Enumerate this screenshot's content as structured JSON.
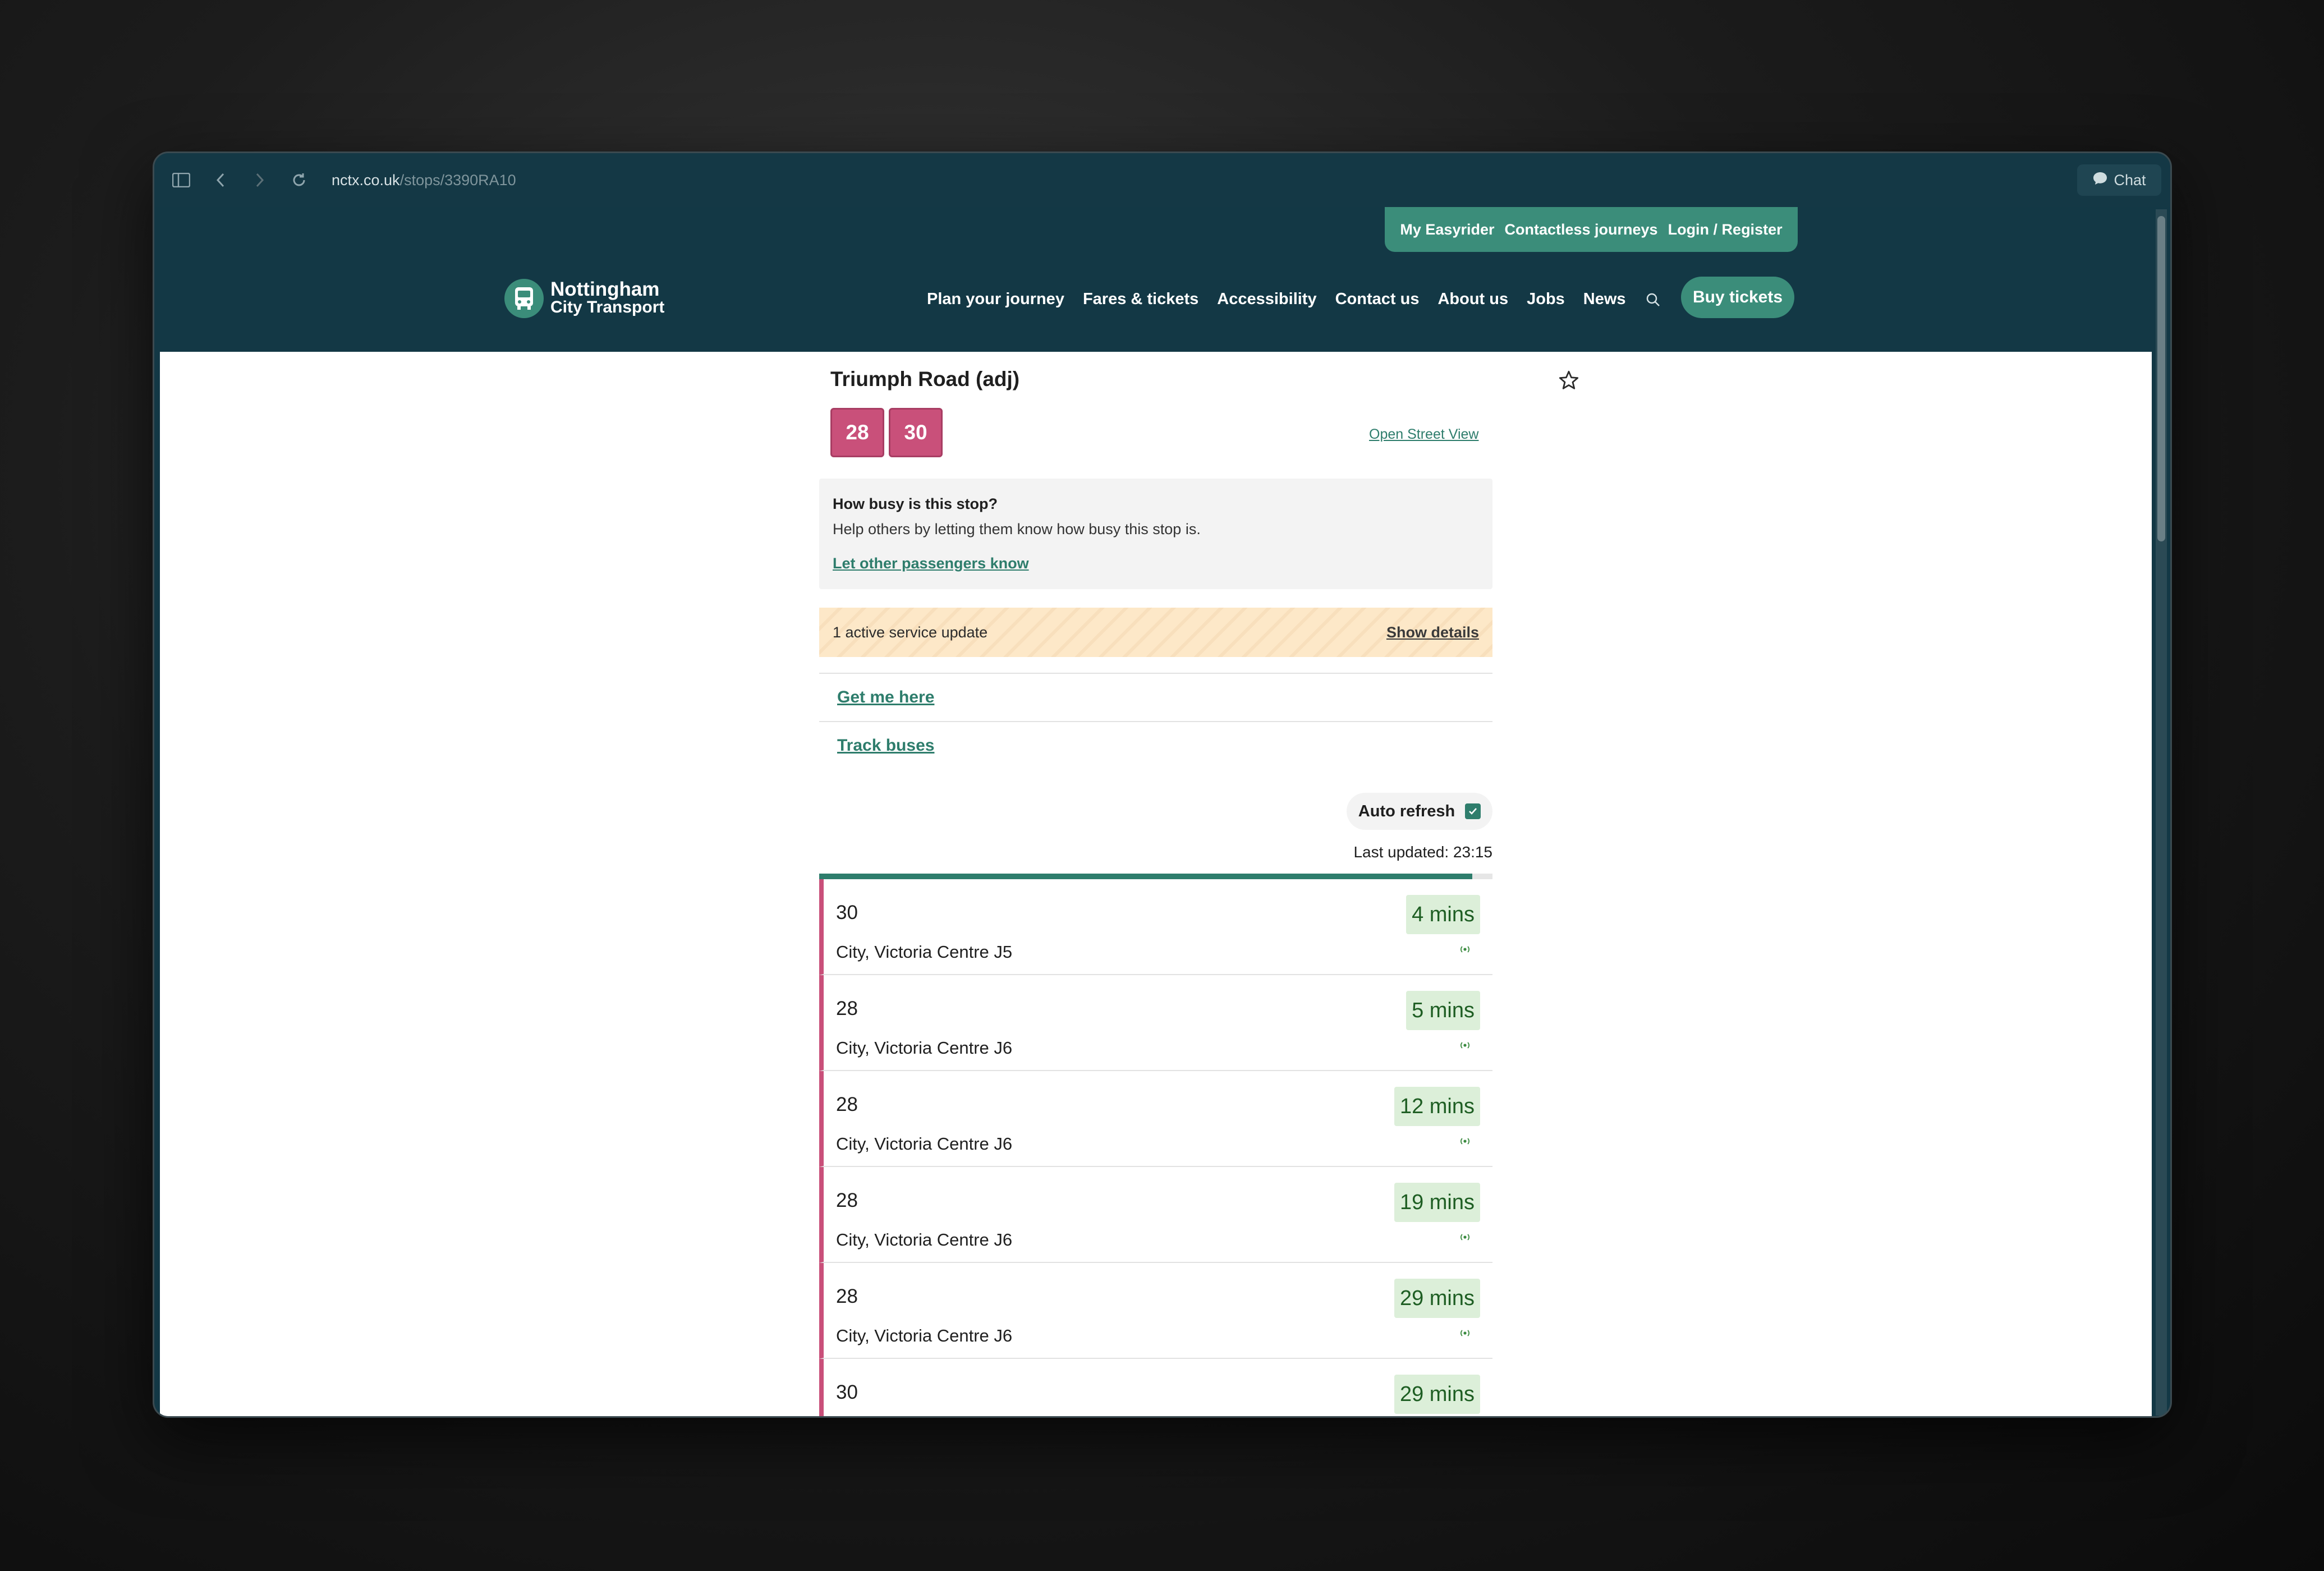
{
  "browser": {
    "url_host": "nctx.co.uk",
    "url_path": "/stops/3390RA10",
    "chat_label": "Chat"
  },
  "header": {
    "utility_links": [
      "My Easyrider",
      "Contactless journeys",
      "Login / Register"
    ],
    "logo_line1": "Nottingham",
    "logo_line2": "City Transport",
    "nav": [
      "Plan your journey",
      "Fares & tickets",
      "Accessibility",
      "Contact us",
      "About us",
      "Jobs",
      "News"
    ],
    "buy_tickets": "Buy tickets"
  },
  "stop": {
    "title": "Triumph Road (adj)",
    "routes": [
      "28",
      "30"
    ],
    "street_view": "Open Street View",
    "busy_question": "How busy is this stop?",
    "busy_help": "Help others by letting them know how busy this stop is.",
    "busy_link": "Let other passengers know",
    "service_update": "1 active service update",
    "show_details": "Show details",
    "get_me_here": "Get me here",
    "track_buses": "Track buses",
    "auto_refresh": "Auto refresh",
    "auto_refresh_checked": true,
    "last_updated": "Last updated: 23:15",
    "refresh_progress": 0.97
  },
  "departures": [
    {
      "route": "30",
      "destination": "City, Victoria Centre J5",
      "time": "4 mins"
    },
    {
      "route": "28",
      "destination": "City, Victoria Centre J6",
      "time": "5 mins"
    },
    {
      "route": "28",
      "destination": "City, Victoria Centre J6",
      "time": "12 mins"
    },
    {
      "route": "28",
      "destination": "City, Victoria Centre J6",
      "time": "19 mins"
    },
    {
      "route": "28",
      "destination": "City, Victoria Centre J6",
      "time": "29 mins"
    },
    {
      "route": "30",
      "destination": "",
      "time": "29 mins"
    }
  ],
  "colors": {
    "header_bg": "#133845",
    "accent_green": "#3b8d7a",
    "route_pink": "#c9507a",
    "time_badge_bg": "#dcefd9"
  }
}
